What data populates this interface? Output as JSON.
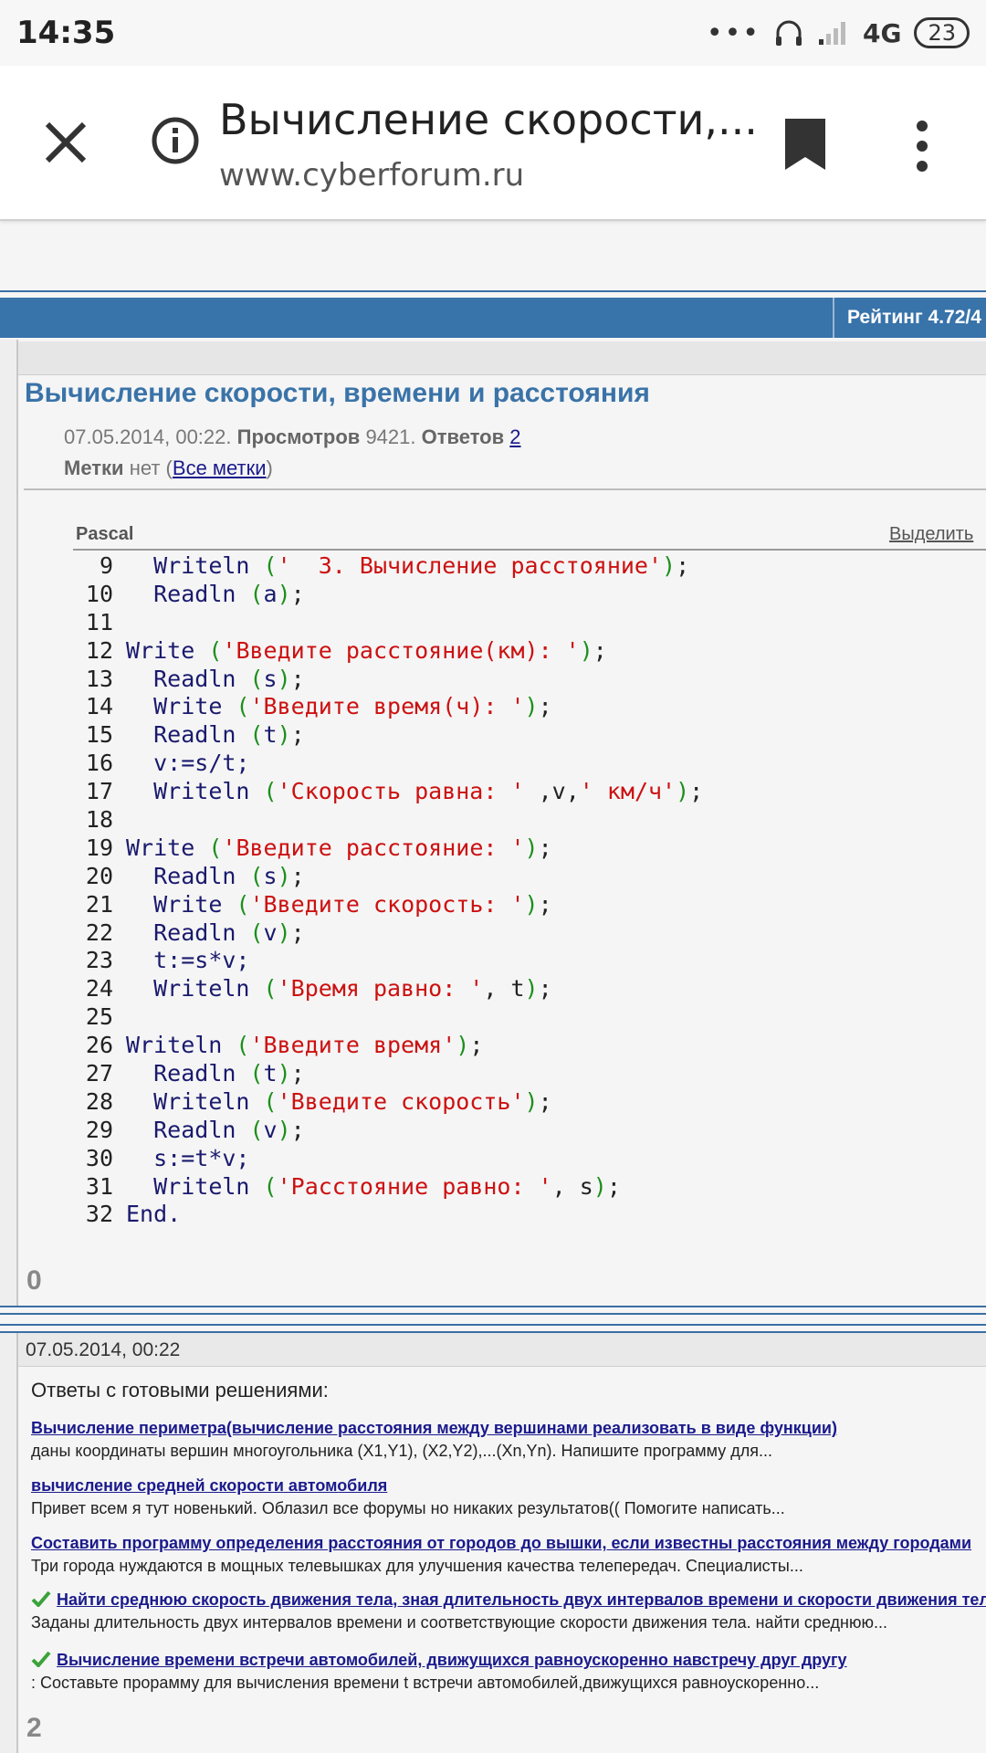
{
  "status_bar": {
    "time": "14:35",
    "network": "4G",
    "battery": "23"
  },
  "browser": {
    "title": "Вычисление скорости,...",
    "url": "www.cyberforum.ru"
  },
  "forum": {
    "rating": "Рейтинг 4.72/4",
    "thread_title": "Вычисление скорости, времени и расстояния",
    "date": "07.05.2014, 00:22.",
    "views_label": "Просмотров",
    "views": "9421.",
    "answers_label": "Ответов",
    "answers": "2",
    "tags_label": "Метки",
    "tags_value": "нет (",
    "all_tags": "Все метки",
    "tags_close": ")"
  },
  "code": {
    "language": "Pascal",
    "select_label": "Выделить"
  },
  "votes": {
    "first": "0",
    "second": "2"
  },
  "post": {
    "date": "07.05.2014, 00:22",
    "heading": "Ответы с готовыми решениями:",
    "answers": [
      {
        "title": "Вычисление периметра(вычисление расстояния между вершинами реализовать в виде функции)",
        "desc": "даны координаты вершин многоугольника (X1,Y1), (X2,Y2),...(Xn,Yn). Напишите программу для...",
        "solved": false
      },
      {
        "title": "вычисление средней скорости автомобиля",
        "desc": "Привет всем я тут новенький. Облазил все форумы но никаких результатов(( Помогите написать...",
        "solved": false
      },
      {
        "title": "Составить программу определения расстояния от городов до вышки, если известны расстояния между городами",
        "desc": "Три города нуждаются в мощных телевышках для улучшения качества телепередач. Специалисты...",
        "solved": false
      },
      {
        "title": "Найти среднюю скорость движения тела, зная длительность двух интервалов времени и скорости движения тела",
        "desc": "Заданы длительность двух интервалов времени и соответствующие скорости движения тела. найти среднюю...",
        "solved": true
      },
      {
        "title": "Вычисление времени встречи автомобилей, движущихся равноускоренно навстречу друг другу",
        "desc": ": Составьте прорамму для вычисления времени t встречи автомобилей,движущихся равноускоренно...",
        "solved": true
      }
    ]
  }
}
